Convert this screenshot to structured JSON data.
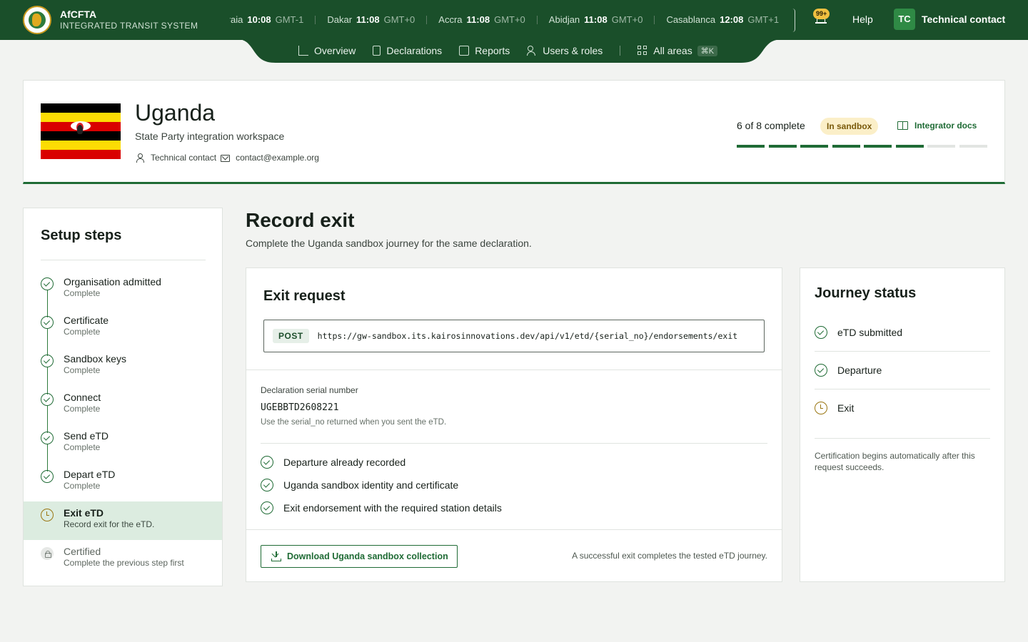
{
  "brand": {
    "name": "AfCFTA",
    "subtitle": "INTEGRATED TRANSIT SYSTEM"
  },
  "clocks": [
    {
      "city": "Praia",
      "time": "10:08",
      "zone": "GMT-1"
    },
    {
      "city": "Dakar",
      "time": "11:08",
      "zone": "GMT+0"
    },
    {
      "city": "Accra",
      "time": "11:08",
      "zone": "GMT+0"
    },
    {
      "city": "Abidjan",
      "time": "11:08",
      "zone": "GMT+0"
    },
    {
      "city": "Casablanca",
      "time": "12:08",
      "zone": "GMT+1"
    }
  ],
  "header": {
    "notifications_badge": "99+",
    "help_label": "Help",
    "user_initials": "TC",
    "user_name": "Technical contact"
  },
  "nav": {
    "items": [
      {
        "label": "Overview",
        "icon": "chart-line-icon"
      },
      {
        "label": "Declarations",
        "icon": "document-icon"
      },
      {
        "label": "Reports",
        "icon": "table-icon"
      },
      {
        "label": "Users & roles",
        "icon": "users-icon"
      }
    ],
    "all_areas": {
      "label": "All areas",
      "shortcut": "⌘K",
      "icon": "grid-icon"
    }
  },
  "workspace": {
    "country": "Uganda",
    "subtitle": "State Party integration workspace",
    "contact_name": "Technical contact",
    "contact_email": "contact@example.org",
    "progress_label": "6 of 8 complete",
    "progress_completed": 6,
    "progress_total": 8,
    "status_pill": "In sandbox",
    "docs_label": "Integrator docs",
    "flag_colors": [
      "#000000",
      "#fcdc04",
      "#d90000",
      "#000000",
      "#fcdc04",
      "#d90000"
    ]
  },
  "sidebar": {
    "title": "Setup steps",
    "steps": [
      {
        "title": "Organisation admitted",
        "sub": "Complete",
        "state": "complete"
      },
      {
        "title": "Certificate",
        "sub": "Complete",
        "state": "complete"
      },
      {
        "title": "Sandbox keys",
        "sub": "Complete",
        "state": "complete"
      },
      {
        "title": "Connect",
        "sub": "Complete",
        "state": "complete"
      },
      {
        "title": "Send eTD",
        "sub": "Complete",
        "state": "complete"
      },
      {
        "title": "Depart eTD",
        "sub": "Complete",
        "state": "complete"
      },
      {
        "title": "Exit eTD",
        "sub": "Record exit for the eTD.",
        "state": "active"
      },
      {
        "title": "Certified",
        "sub": "Complete the previous step first",
        "state": "locked"
      }
    ]
  },
  "main": {
    "title": "Record exit",
    "subtitle": "Complete the Uganda sandbox journey for the same declaration."
  },
  "exit_card": {
    "title": "Exit request",
    "method": "POST",
    "url": "https://gw-sandbox.its.kairosinnovations.dev/api/v1/etd/{serial_no}/endorsements/exit",
    "serial_label": "Declaration serial number",
    "serial_value": "UGEBBTD2608221",
    "serial_hint": "Use the serial_no returned when you sent the eTD.",
    "requirements": [
      "Departure already recorded",
      "Uganda sandbox identity and certificate",
      "Exit endorsement with the required station details"
    ],
    "download_label": "Download Uganda sandbox collection",
    "foot_note": "A successful exit completes the tested eTD journey."
  },
  "journey": {
    "title": "Journey status",
    "items": [
      {
        "label": "eTD submitted",
        "state": "done"
      },
      {
        "label": "Departure",
        "state": "done"
      },
      {
        "label": "Exit",
        "state": "pending"
      }
    ],
    "note": "Certification begins automatically after this request succeeds."
  },
  "colors": {
    "brand_green": "#1a4f2a",
    "accent_green": "#1f6b35",
    "pending_amber": "#9a7612",
    "sandbox_pill_bg": "#fbefc8"
  }
}
